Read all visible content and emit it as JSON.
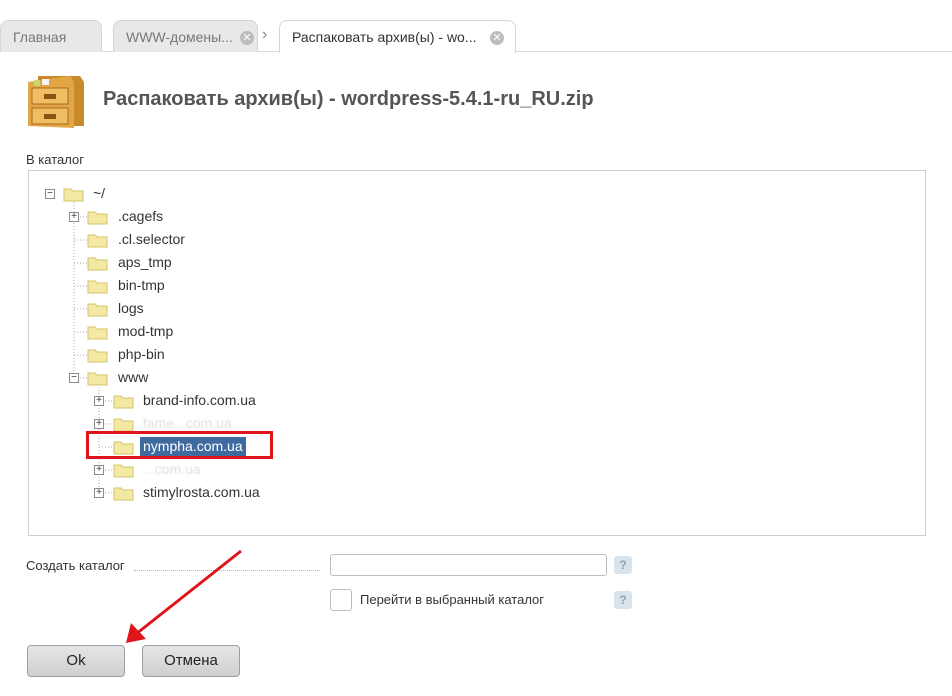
{
  "tabs": [
    {
      "label": "Главная"
    },
    {
      "label": "WWW-домены..."
    },
    {
      "label": "Распаковать архив(ы) - wo..."
    }
  ],
  "page": {
    "title": "Распаковать архив(ы) - wordpress-5.4.1-ru_RU.zip"
  },
  "tree": {
    "label": "В каталог",
    "root": "~/",
    "items": [
      ".cagefs",
      ".cl.selector",
      "aps_tmp",
      "bin-tmp",
      "logs",
      "mod-tmp",
      "php-bin",
      "www"
    ],
    "www_children": [
      "brand-info.com.ua",
      "fame...com.ua",
      "nympha.com.ua",
      "...com.ua",
      "stimylrosta.com.ua"
    ],
    "selected": "nympha.com.ua"
  },
  "form": {
    "create_dir_label": "Создать каталог",
    "create_dir_value": "",
    "goto_label": "Перейти в выбранный каталог",
    "goto_checked": false,
    "help_glyph": "?"
  },
  "buttons": {
    "ok": "Ok",
    "cancel": "Отмена"
  },
  "colors": {
    "highlight": "#e0141b",
    "selection": "#3f6aa0",
    "folder": "#f3e9a4"
  }
}
